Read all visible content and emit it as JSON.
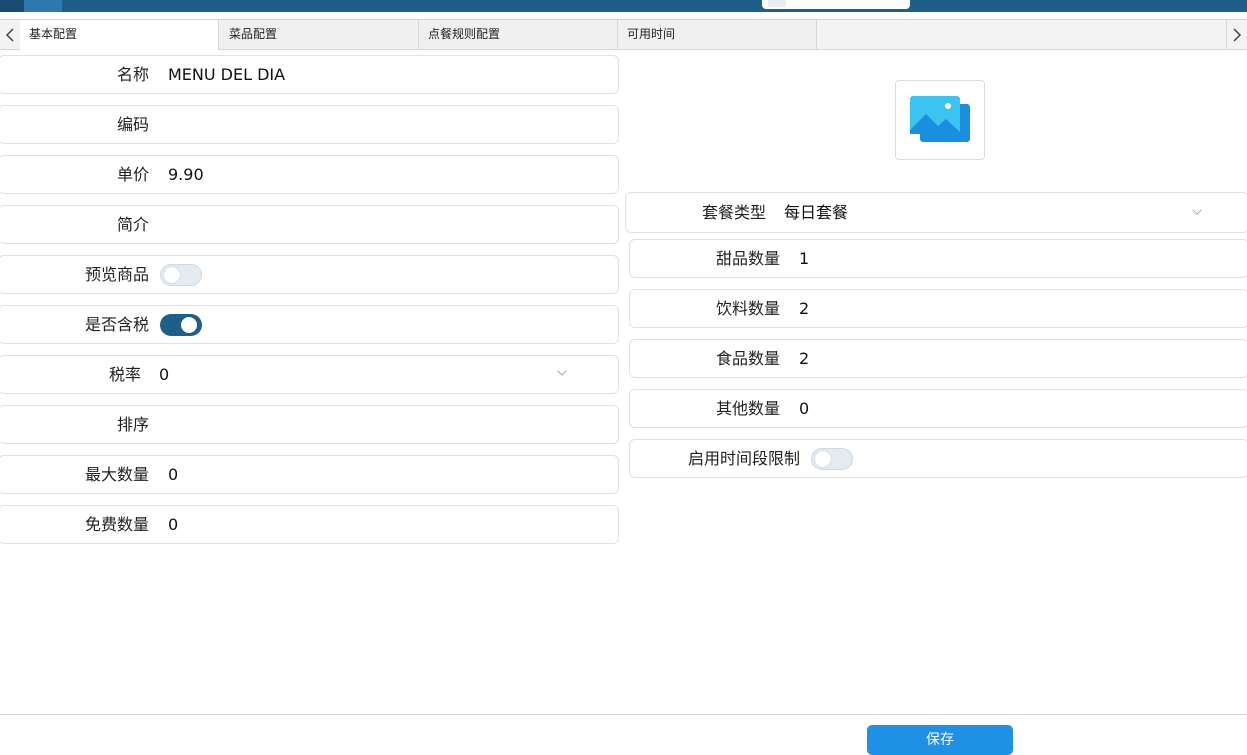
{
  "tabs": [
    "基本配置",
    "菜品配置",
    "点餐规则配置",
    "可用时间"
  ],
  "left_fields": [
    {
      "label": "名称",
      "value": "MENU DEL DIA"
    },
    {
      "label": "编码",
      "value": ""
    },
    {
      "label": "单价",
      "value": "9.90"
    },
    {
      "label": "简介",
      "value": ""
    },
    {
      "label": "预览商品",
      "toggle": false
    },
    {
      "label": "是否含税",
      "toggle": true
    },
    {
      "label": "税率",
      "value": "0"
    },
    {
      "label": "排序",
      "value": ""
    },
    {
      "label": "最大数量",
      "value": "0"
    },
    {
      "label": "免费数量",
      "value": "0"
    }
  ],
  "right_fields": [
    {
      "label": "套餐类型",
      "value": "每日套餐"
    },
    {
      "label": "甜品数量",
      "value": "1"
    },
    {
      "label": "饮料数量",
      "value": "2"
    },
    {
      "label": "食品数量",
      "value": "2"
    },
    {
      "label": "其他数量",
      "value": "0"
    },
    {
      "label": "启用时间段限制",
      "toggle": false
    }
  ],
  "footer": {
    "save_label": "保存"
  },
  "colors": {
    "accent": "#1e5f8a",
    "button": "#1e90e6"
  },
  "icons": {
    "image_placeholder": "image-placeholder-icon"
  }
}
